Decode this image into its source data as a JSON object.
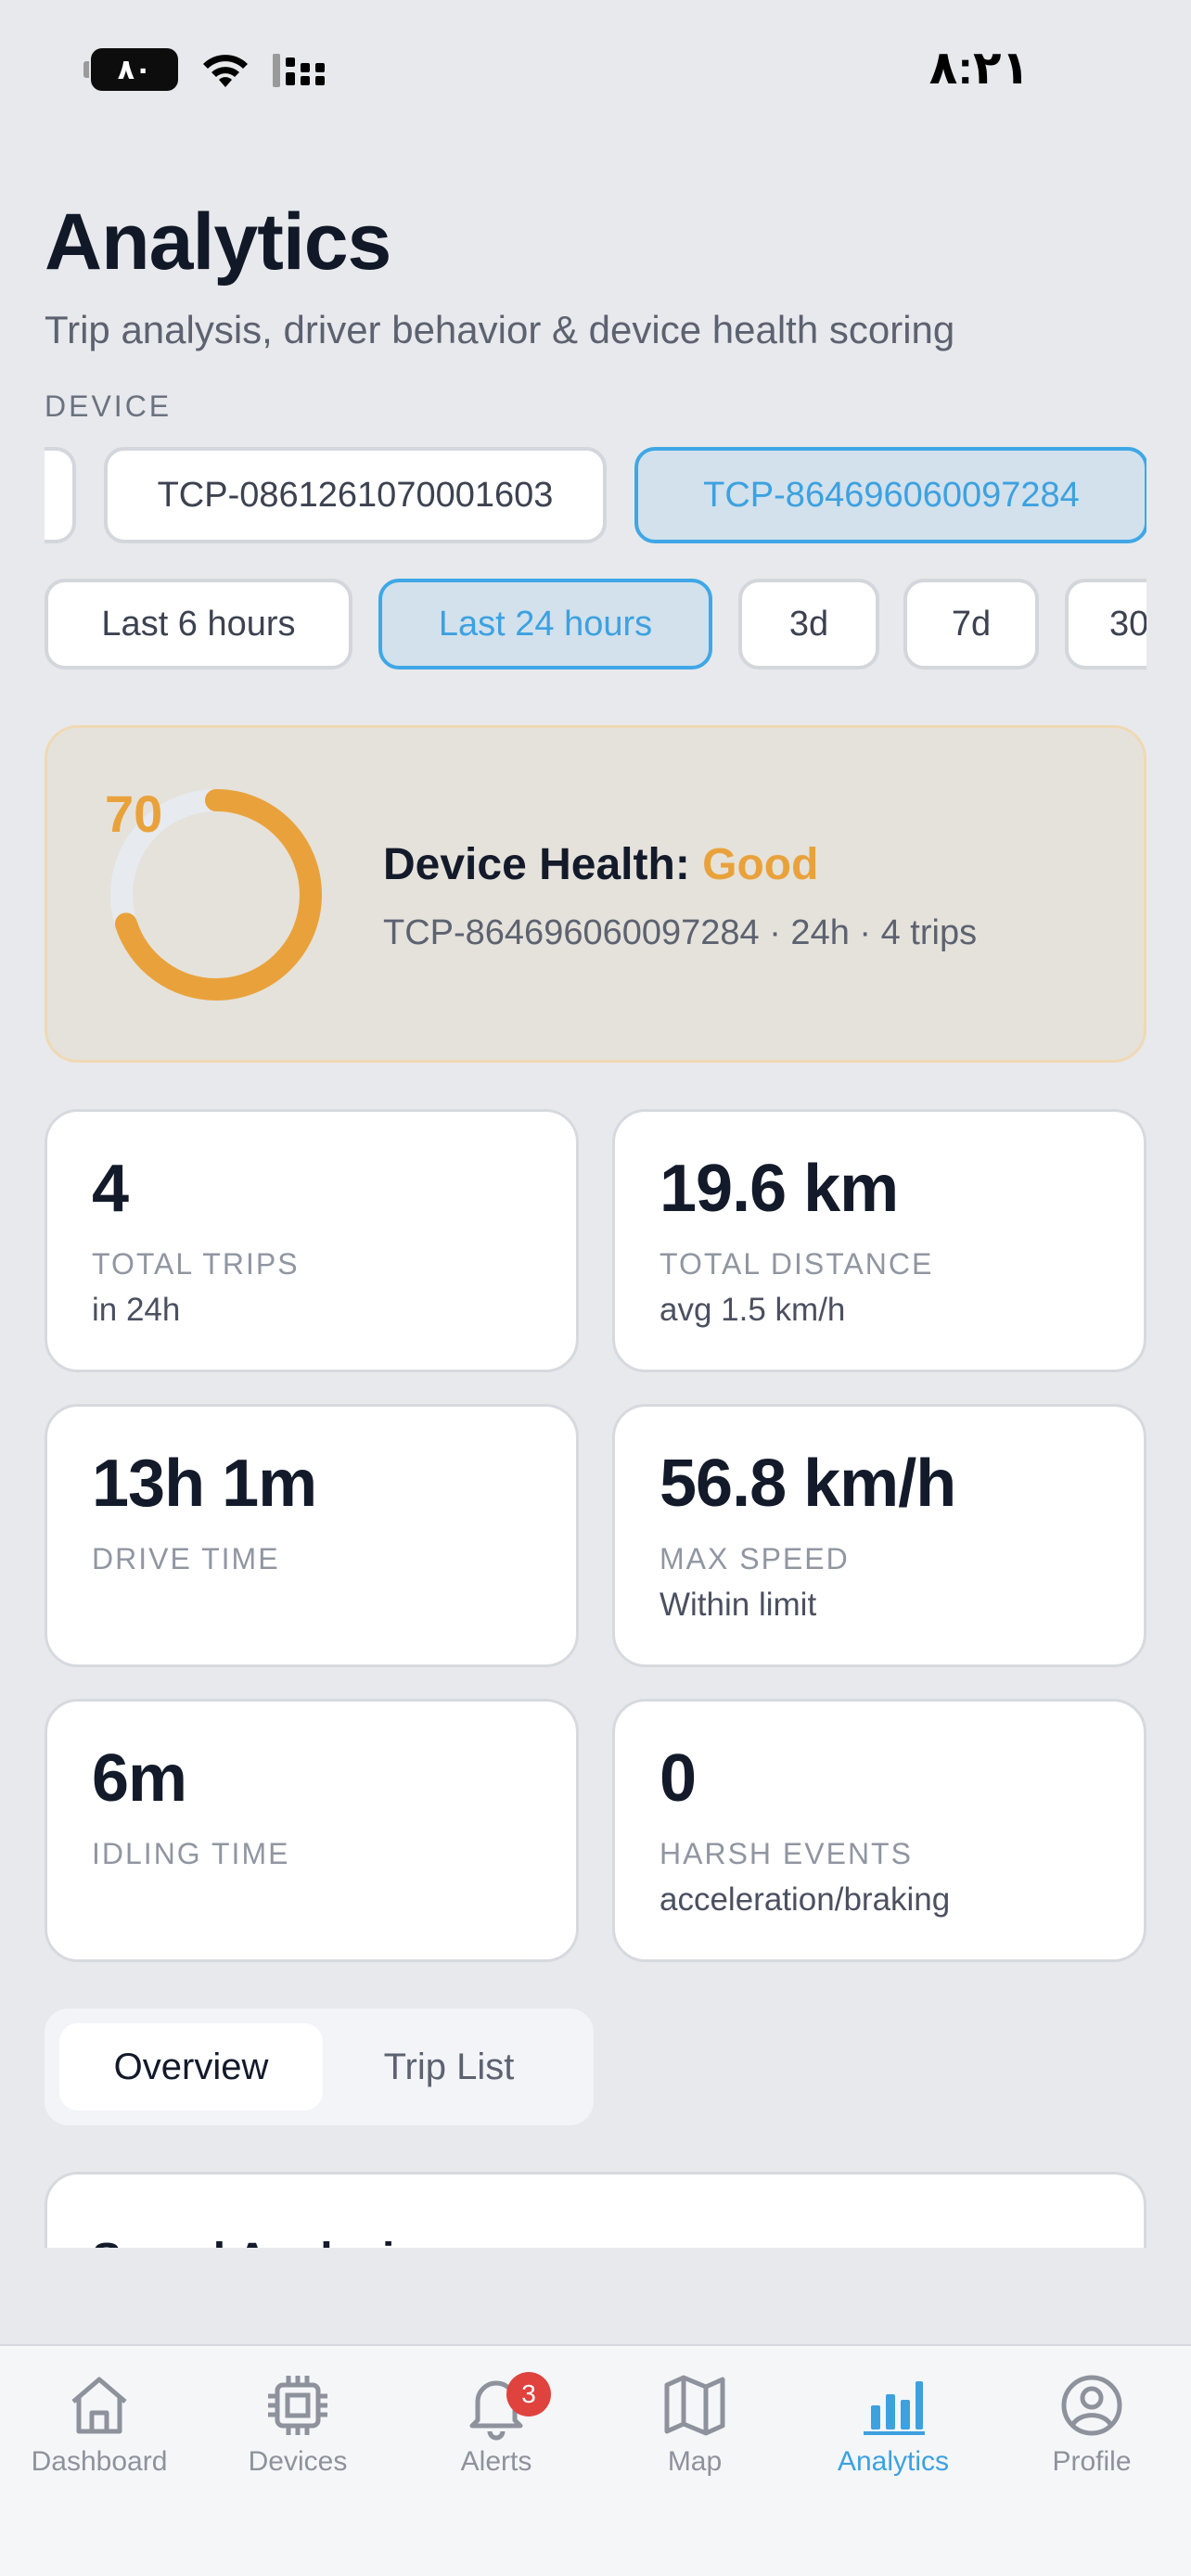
{
  "status_bar": {
    "battery": "٨٠",
    "time": "٨:٢١"
  },
  "header": {
    "title": "Analytics",
    "subtitle": "Trip analysis, driver behavior & device health scoring"
  },
  "device_section": {
    "label": "DEVICE",
    "devices": [
      "TCP-0861261070001603",
      "TCP-864696060097284"
    ],
    "selected": "TCP-864696060097284"
  },
  "time_ranges": {
    "options": [
      "Last 6 hours",
      "Last 24 hours",
      "3d",
      "7d",
      "30"
    ],
    "selected": "Last 24 hours"
  },
  "health": {
    "score": 70,
    "score_label": "70",
    "score_fraction": 0.7,
    "title_prefix": "Device Health: ",
    "status": "Good",
    "meta": "TCP-864696060097284 · 24h · 4 trips",
    "accent_color": "#e9a23b"
  },
  "stats": [
    {
      "value": "4",
      "label": "TOTAL TRIPS",
      "sub": "in 24h"
    },
    {
      "value": "19.6 km",
      "label": "TOTAL DISTANCE",
      "sub": "avg 1.5 km/h"
    },
    {
      "value": "13h 1m",
      "label": "DRIVE TIME",
      "sub": ""
    },
    {
      "value": "56.8 km/h",
      "label": "MAX SPEED",
      "sub": "Within limit"
    },
    {
      "value": "6m",
      "label": "IDLING TIME",
      "sub": ""
    },
    {
      "value": "0",
      "label": "HARSH EVENTS",
      "sub": "acceleration/braking"
    }
  ],
  "tabs": {
    "items": [
      "Overview",
      "Trip List"
    ],
    "selected": "Overview"
  },
  "speed_card": {
    "title": "Speed Analysis"
  },
  "bottom_nav": {
    "items": [
      {
        "label": "Dashboard",
        "icon": "home-icon"
      },
      {
        "label": "Devices",
        "icon": "chip-icon"
      },
      {
        "label": "Alerts",
        "icon": "bell-icon",
        "badge": "3"
      },
      {
        "label": "Map",
        "icon": "map-icon"
      },
      {
        "label": "Analytics",
        "icon": "bar-chart-icon"
      },
      {
        "label": "Profile",
        "icon": "user-circle-icon"
      }
    ],
    "active": "Analytics",
    "active_color": "#3da1e0"
  }
}
